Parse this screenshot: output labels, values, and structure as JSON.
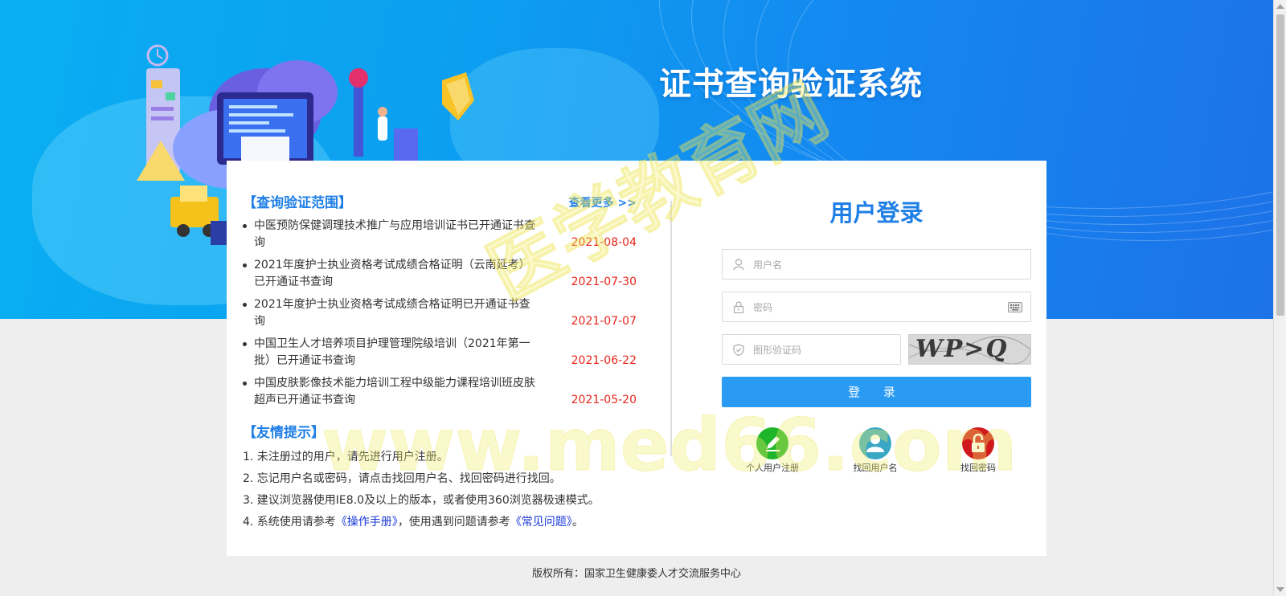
{
  "header": {
    "title": "证书查询验证系统"
  },
  "scope": {
    "title": "【查询验证范围】",
    "more": "查看更多 >>",
    "items": [
      {
        "text": "中医预防保健调理技术推广与应用培训证书已开通证书查询",
        "date": "2021-08-04"
      },
      {
        "text": "2021年度护士执业资格考试成绩合格证明（云南延考）已开通证书查询",
        "date": "2021-07-30"
      },
      {
        "text": "2021年度护士执业资格考试成绩合格证明已开通证书查询",
        "date": "2021-07-07"
      },
      {
        "text": "中国卫生人才培养项目护理管理院级培训（2021年第一批）已开通证书查询",
        "date": "2021-06-22"
      },
      {
        "text": "中国皮肤影像技术能力培训工程中级能力课程培训班皮肤超声已开通证书查询",
        "date": "2021-05-20"
      }
    ]
  },
  "tips": {
    "title": "【友情提示】",
    "items": [
      "1. 未注册过的用户，请先进行用户注册。",
      "2. 忘记用户名或密码，请点击找回用户名、找回密码进行找回。",
      "3. 建议浏览器使用IE8.0及以上的版本，或者使用360浏览器极速模式。"
    ],
    "item4": {
      "prefix": "4. 系统使用请参考",
      "manual": "《操作手册》",
      "middle": "，使用遇到问题请参考",
      "faq": "《常见问题》",
      "suffix": "。"
    }
  },
  "login": {
    "title": "用户登录",
    "username_placeholder": "用户名",
    "password_placeholder": "密码",
    "captcha_placeholder": "图形验证码",
    "captcha_text": "WP>Q",
    "button": "登 录",
    "register": "个人用户注册",
    "find_username": "找回用户名",
    "find_password": "找回密码"
  },
  "footer": {
    "copyright": "版权所有：国家卫生健康委人才交流服务中心"
  },
  "watermark": {
    "line1": "医学教育网",
    "line2": "www.med66.com"
  },
  "colors": {
    "accent": "#1f7fe6",
    "date": "#e8261a",
    "button": "#2a9bf2",
    "register": "#1fb52b",
    "find_username": "#3aa8c4",
    "find_password": "#d0191c"
  }
}
